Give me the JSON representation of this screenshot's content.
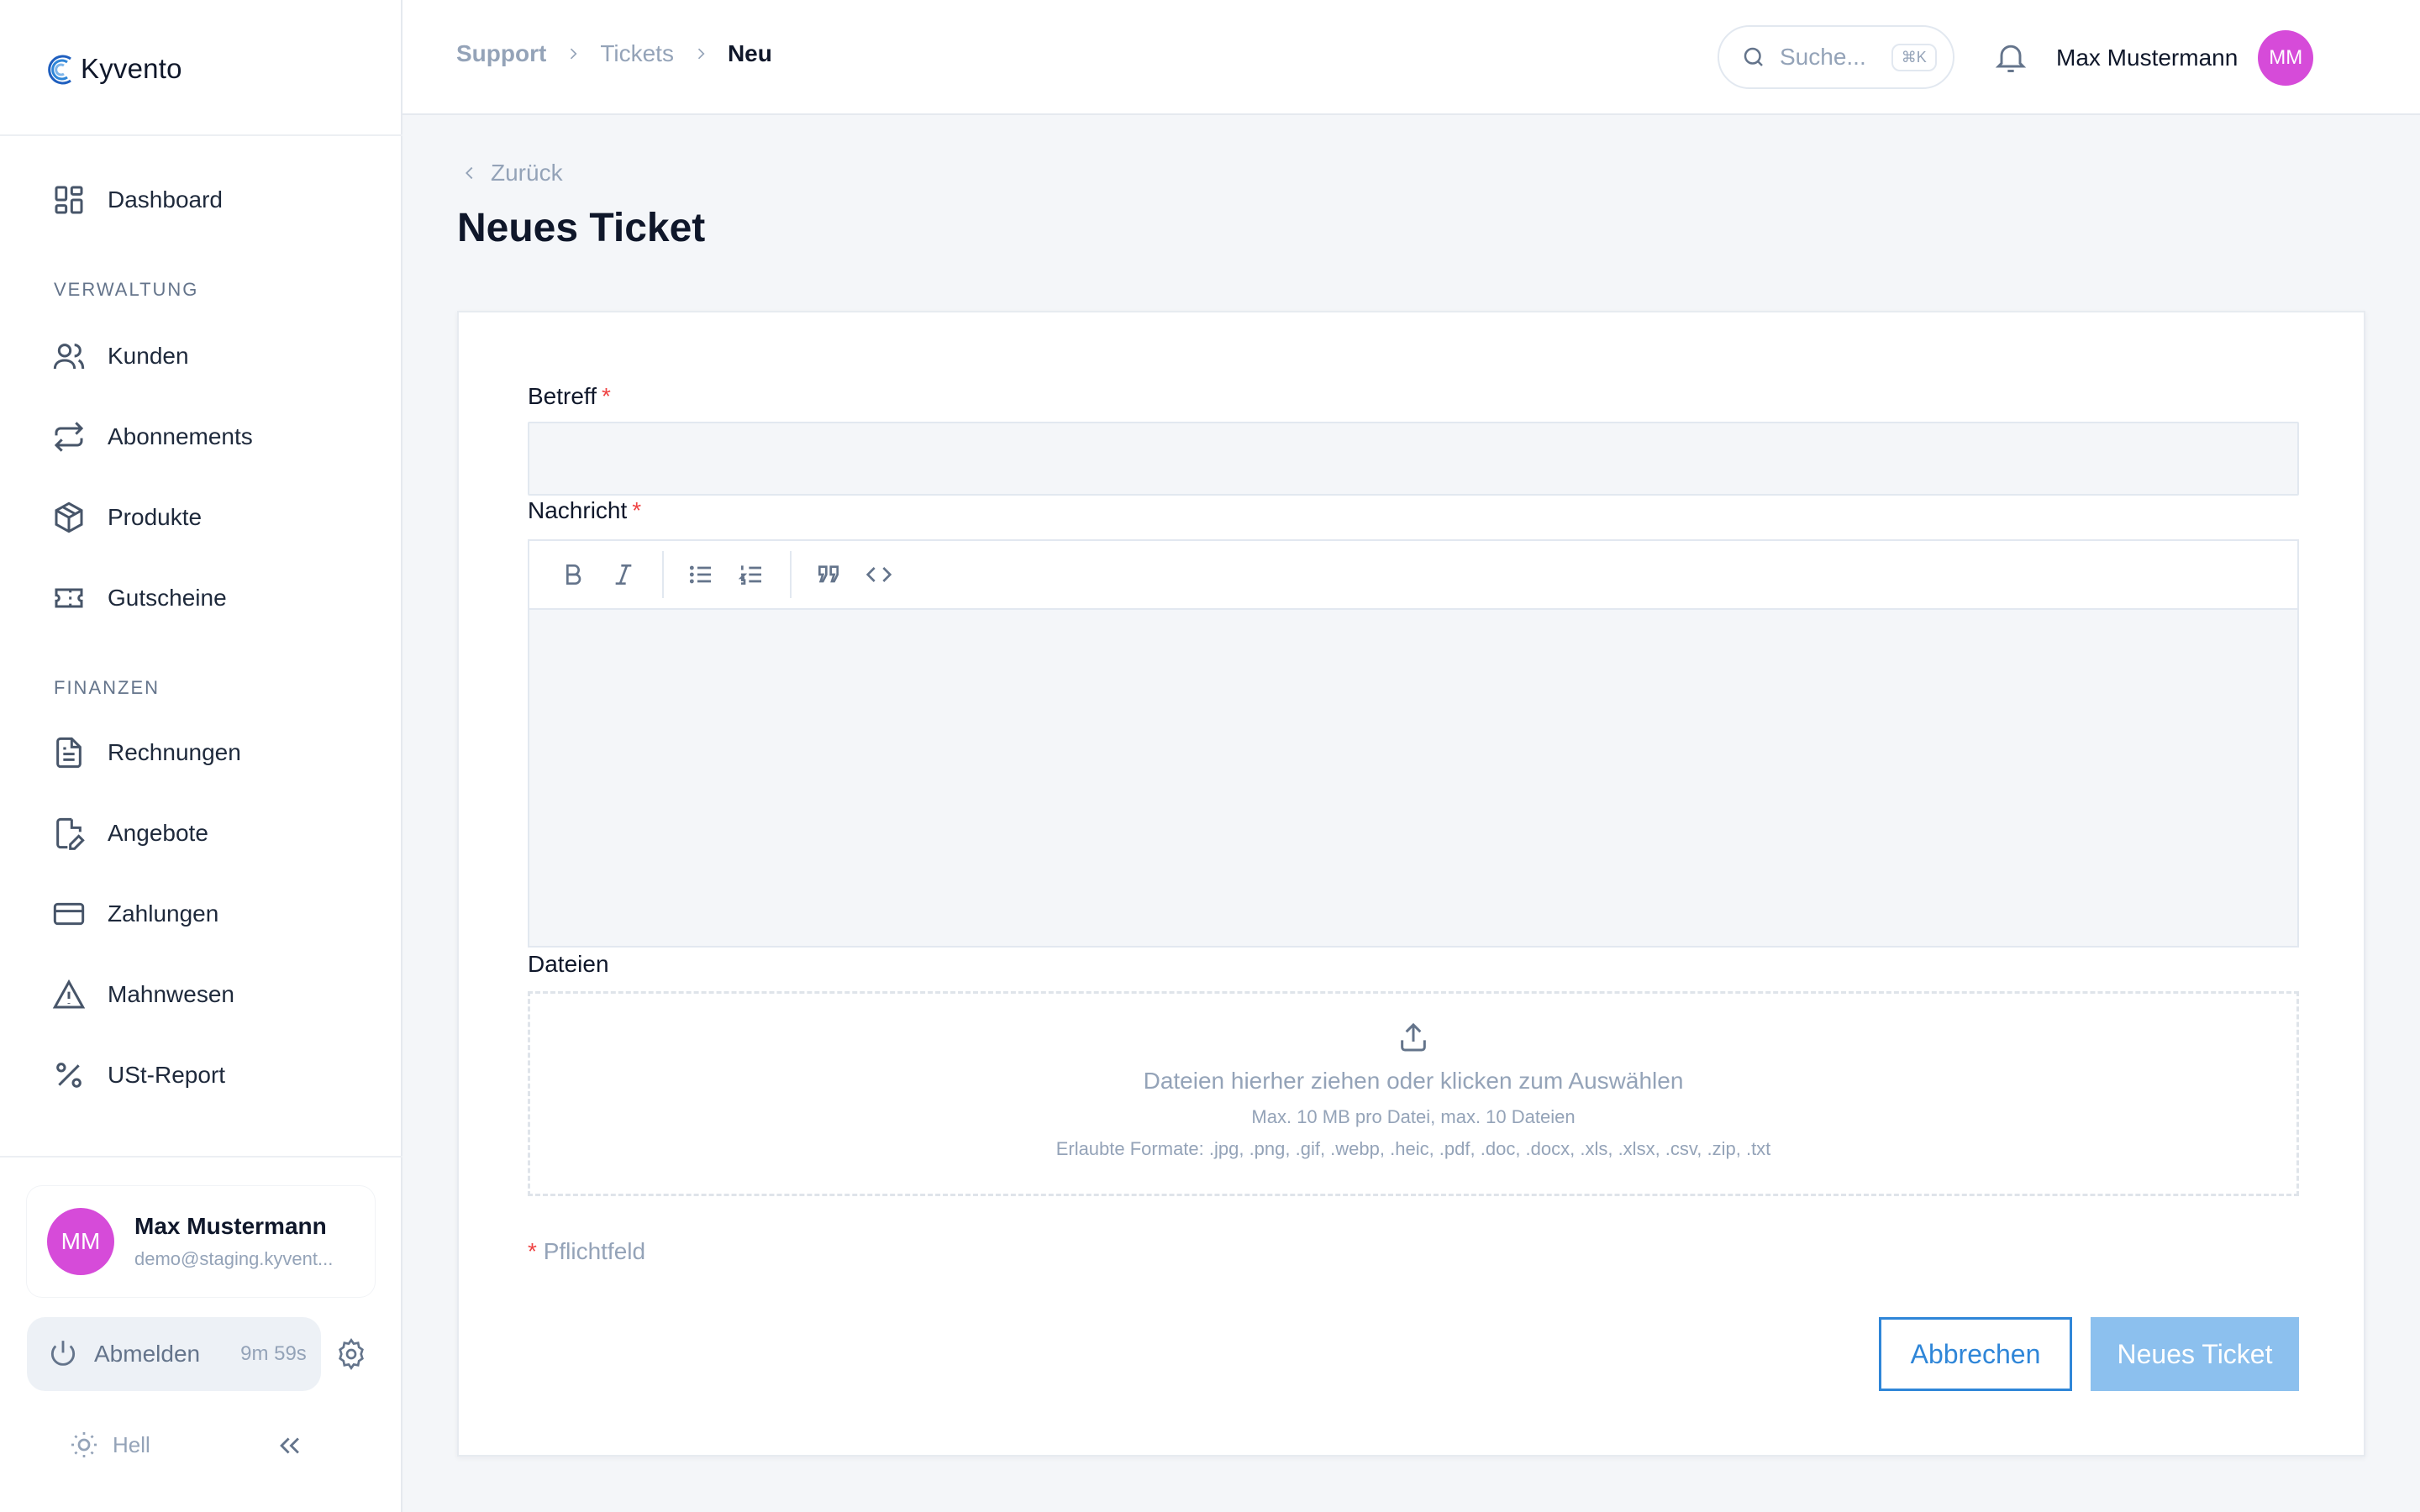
{
  "app": {
    "brand": "Kyvento"
  },
  "sidebar": {
    "items": [
      {
        "label": "Dashboard",
        "icon": "dashboard-icon"
      },
      {
        "label": "Kunden",
        "icon": "users-icon"
      },
      {
        "label": "Abonnements",
        "icon": "repeat-icon"
      },
      {
        "label": "Produkte",
        "icon": "package-icon"
      },
      {
        "label": "Gutscheine",
        "icon": "ticket-icon"
      },
      {
        "label": "Rechnungen",
        "icon": "file-text-icon"
      },
      {
        "label": "Angebote",
        "icon": "file-edit-icon"
      },
      {
        "label": "Zahlungen",
        "icon": "credit-card-icon"
      },
      {
        "label": "Mahnwesen",
        "icon": "alert-triangle-icon"
      },
      {
        "label": "USt-Report",
        "icon": "percent-icon"
      }
    ],
    "sections": {
      "verwaltung": "VERWALTUNG",
      "finanzen": "FINANZEN"
    },
    "user": {
      "initials": "MM",
      "name": "Max Mustermann",
      "email": "demo@staging.kyvent..."
    },
    "logout": {
      "label": "Abmelden",
      "timer": "9m 59s"
    },
    "theme": {
      "label": "Hell"
    }
  },
  "topbar": {
    "breadcrumb": [
      "Support",
      "Tickets",
      "Neu"
    ],
    "search": {
      "placeholder": "Suche...",
      "shortcut": "⌘K"
    },
    "user": {
      "name": "Max Mustermann",
      "initials": "MM"
    }
  },
  "page": {
    "back_label": "Zurück",
    "title": "Neues Ticket"
  },
  "form": {
    "subject_label": "Betreff",
    "subject_value": "",
    "message_label": "Nachricht",
    "required_mark": "*",
    "files_label": "Dateien",
    "dropzone": {
      "main": "Dateien hierher ziehen oder klicken zum Auswählen",
      "limits": "Max. 10 MB pro Datei, max. 10 Dateien",
      "formats": "Erlaubte Formate: .jpg, .png, .gif, .webp, .heic, .pdf, .doc, .docx, .xls, .xlsx, .csv, .zip, .txt"
    },
    "required_note": "Pflichtfeld",
    "cancel_label": "Abbrechen",
    "submit_label": "Neues Ticket"
  },
  "colors": {
    "accent": "#2f86d8",
    "avatar": "#d64bd9",
    "required": "#ef4444"
  }
}
